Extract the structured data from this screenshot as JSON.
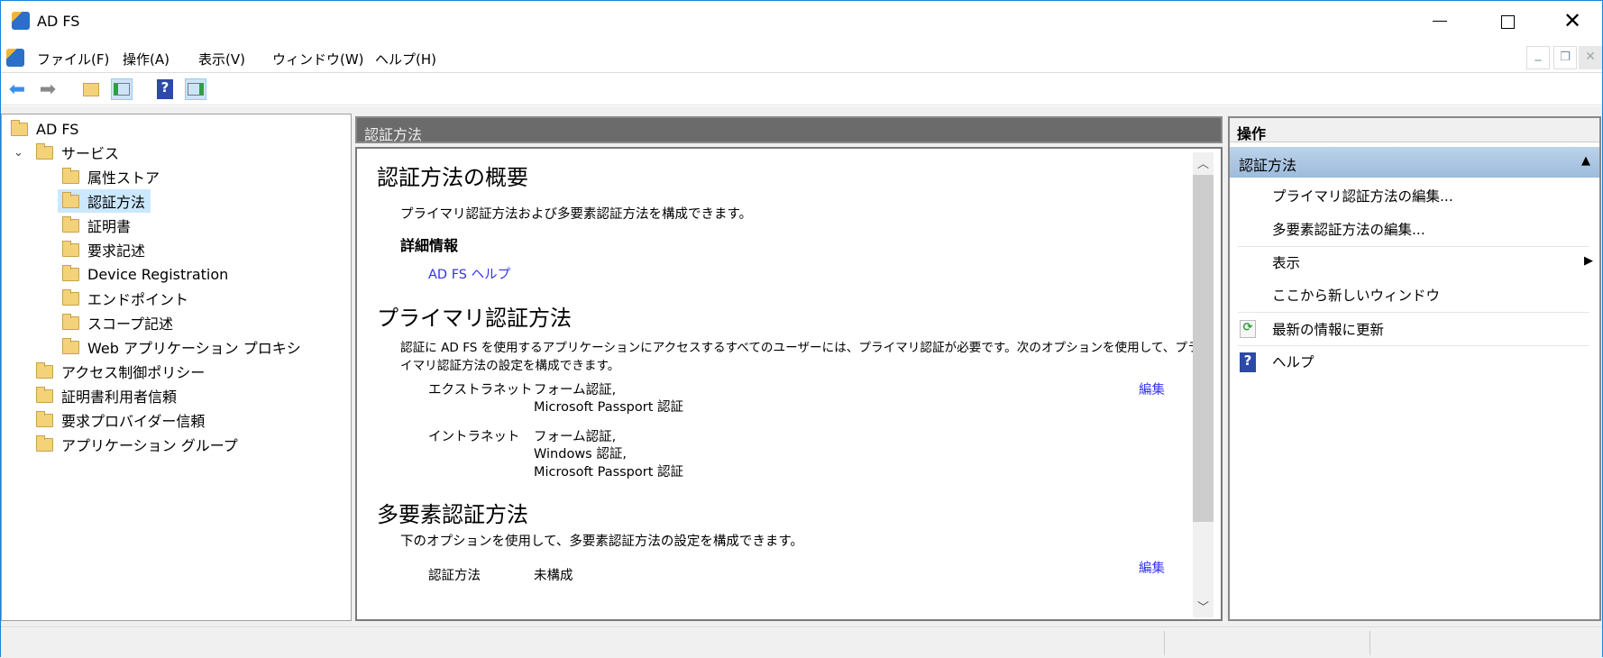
{
  "window": {
    "title": "AD FS"
  },
  "menu": [
    "ファイル(F)",
    "操作(A)",
    "表示(V)",
    "ウィンドウ(W)",
    "ヘルプ(H)"
  ],
  "tree": {
    "root": "AD FS",
    "service": "サービス",
    "service_children": [
      "属性ストア",
      "認証方法",
      "証明書",
      "要求記述",
      "Device Registration",
      "エンドポイント",
      "スコープ記述",
      "Web アプリケーション プロキシ"
    ],
    "others": [
      "アクセス制御ポリシー",
      "証明書利用者信頼",
      "要求プロバイダー信頼",
      "アプリケーション グループ"
    ],
    "selected": "認証方法"
  },
  "center": {
    "header": "認証方法",
    "overview_title": "認証方法の概要",
    "overview_desc": "プライマリ認証方法および多要素認証方法を構成できます。",
    "details_title": "詳細情報",
    "help_link": "AD FS ヘルプ",
    "primary_title": "プライマリ認証方法",
    "primary_desc1": "認証に AD FS を使用するアプリケーションにアクセスするすべてのユーザーには、プライマリ認証が必要です。次のオプションを使用して、プラ",
    "primary_desc2": "イマリ認証方法の設定を構成できます。",
    "extranet_label": "エクストラネット",
    "extranet_values": [
      "フォーム認証,",
      "Microsoft Passport 認証"
    ],
    "intranet_label": "イントラネット",
    "intranet_values": [
      "フォーム認証,",
      "Windows 認証,",
      "Microsoft Passport 認証"
    ],
    "edit": "編集",
    "mfa_title": "多要素認証方法",
    "mfa_desc": "下のオプションを使用して、多要素認証方法の設定を構成できます。",
    "mfa_label": "認証方法",
    "mfa_value": "未構成"
  },
  "actions": {
    "header": "操作",
    "section": "認証方法",
    "items": [
      "プライマリ認証方法の編集...",
      "多要素認証方法の編集...",
      "表示",
      "ここから新しいウィンドウ",
      "最新の情報に更新",
      "ヘルプ"
    ]
  },
  "colors": {
    "link": "#3333ee",
    "header_bg": "#6b6b6b",
    "section_bg": "#a9c4e2",
    "selection": "#cce8ff"
  }
}
